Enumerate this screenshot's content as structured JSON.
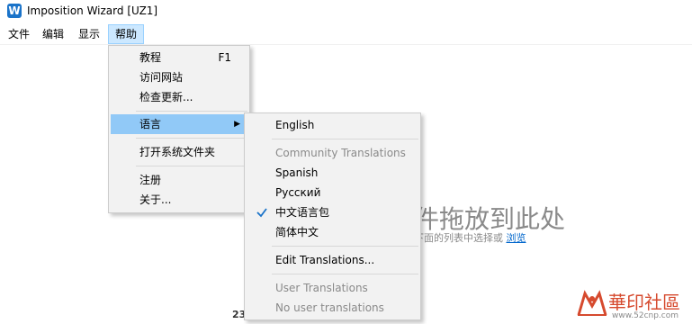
{
  "titlebar": {
    "icon_letter": "W",
    "title": "Imposition Wizard [UZ1]"
  },
  "menubar": {
    "items": [
      "文件",
      "编辑",
      "显示",
      "帮助"
    ]
  },
  "help_menu": {
    "items": [
      {
        "label": "教程",
        "shortcut": "F1"
      },
      {
        "label": "访问网站"
      },
      {
        "label": "检查更新..."
      },
      {
        "label": "语言"
      },
      {
        "label": "打开系统文件夹"
      },
      {
        "label": "注册"
      },
      {
        "label": "关于..."
      }
    ]
  },
  "language_menu": {
    "english": "English",
    "community_header": "Community Translations",
    "spanish": "Spanish",
    "russian": "Русский",
    "chinese_pack": "中文语言包",
    "simplified_chinese": "简体中文",
    "edit_translations": "Edit Translations...",
    "user_header": "User Translations",
    "no_user": "No user translations"
  },
  "background": {
    "heading": "件拖放到此处",
    "sub_text": "下面的列表中选择或 ",
    "browse_link": "浏览",
    "page_number": "23"
  },
  "watermark": {
    "text": "華印社區",
    "url": "www.52cnp.com"
  },
  "colors": {
    "highlight": "#91c9f7",
    "menu_bg": "#f2f2f2",
    "active_menu": "#cce8ff",
    "link": "#0066cc"
  }
}
